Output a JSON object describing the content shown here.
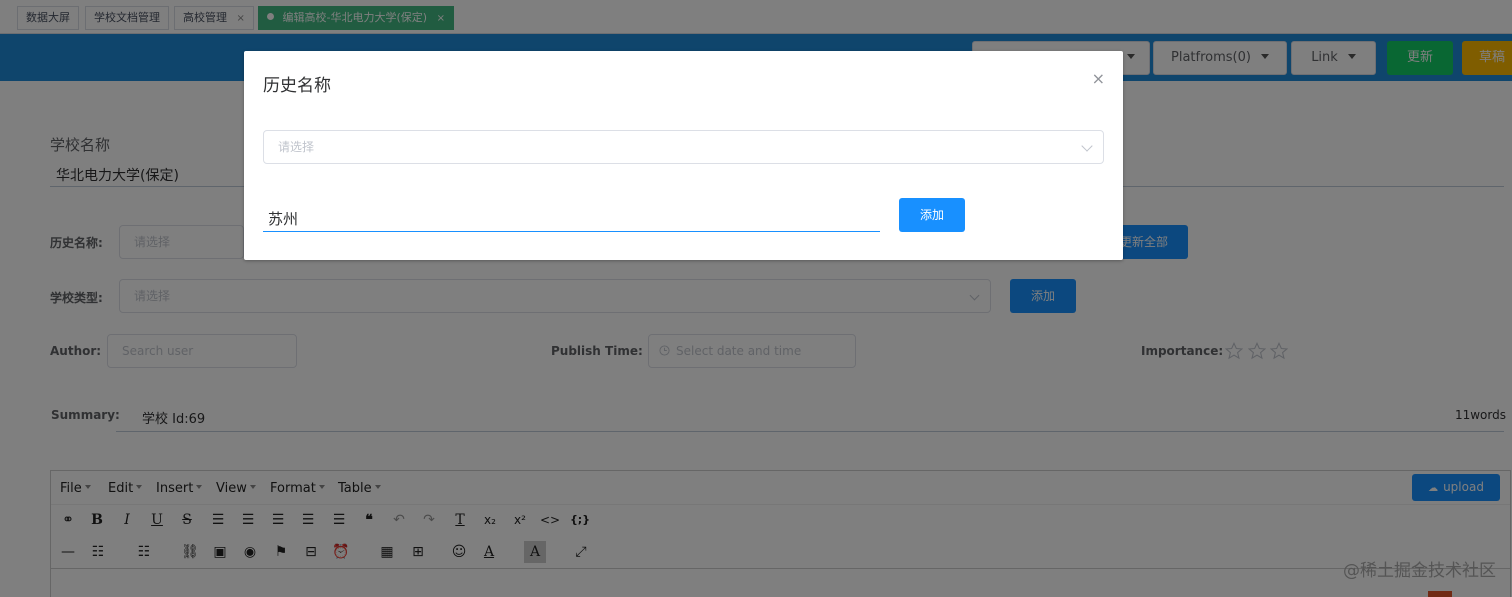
{
  "tags": [
    {
      "label": "数据大屏",
      "closable": false,
      "active": false
    },
    {
      "label": "学校文档管理",
      "closable": false,
      "active": false
    },
    {
      "label": "高校管理",
      "closable": true,
      "active": false
    },
    {
      "label": "编辑高校-华北电力大学(保定)",
      "closable": true,
      "active": true
    }
  ],
  "close_glyph": "×",
  "header": {
    "platforms_label": "Platfroms(0)",
    "link_label": "Link",
    "update_label": "更新",
    "draft_label": "草稿"
  },
  "form": {
    "school_name_label": "学校名称",
    "school_name_value": "华北电力大学(保定)",
    "history_label": "历史名称:",
    "history_placeholder": "请选择",
    "update_all_label": "更新全部",
    "type_label": "学校类型:",
    "type_placeholder": "请选择",
    "type_add_label": "添加",
    "author_label": "Author:",
    "author_placeholder": "Search user",
    "publish_label": "Publish Time:",
    "publish_placeholder": "Select date and time",
    "importance_label": "Importance:",
    "importance_stars": 0,
    "importance_max": 3,
    "summary_label": "Summary:",
    "summary_value": "学校 Id:69",
    "word_count": "11words"
  },
  "editor": {
    "menus": [
      "File",
      "Edit",
      "Insert",
      "View",
      "Format",
      "Table"
    ],
    "upload_label": "upload"
  },
  "dialog": {
    "title": "历史名称",
    "close_icon": "×",
    "select_placeholder": "请选择",
    "input_value": "苏州",
    "add_label": "添加"
  },
  "watermark": "@稀土掘金技术社区",
  "colors": {
    "header_blue": "#1f8ad8",
    "active_tag": "#42b983",
    "primary": "#1890ff",
    "success": "#13ce66",
    "warning": "#ffba00"
  }
}
